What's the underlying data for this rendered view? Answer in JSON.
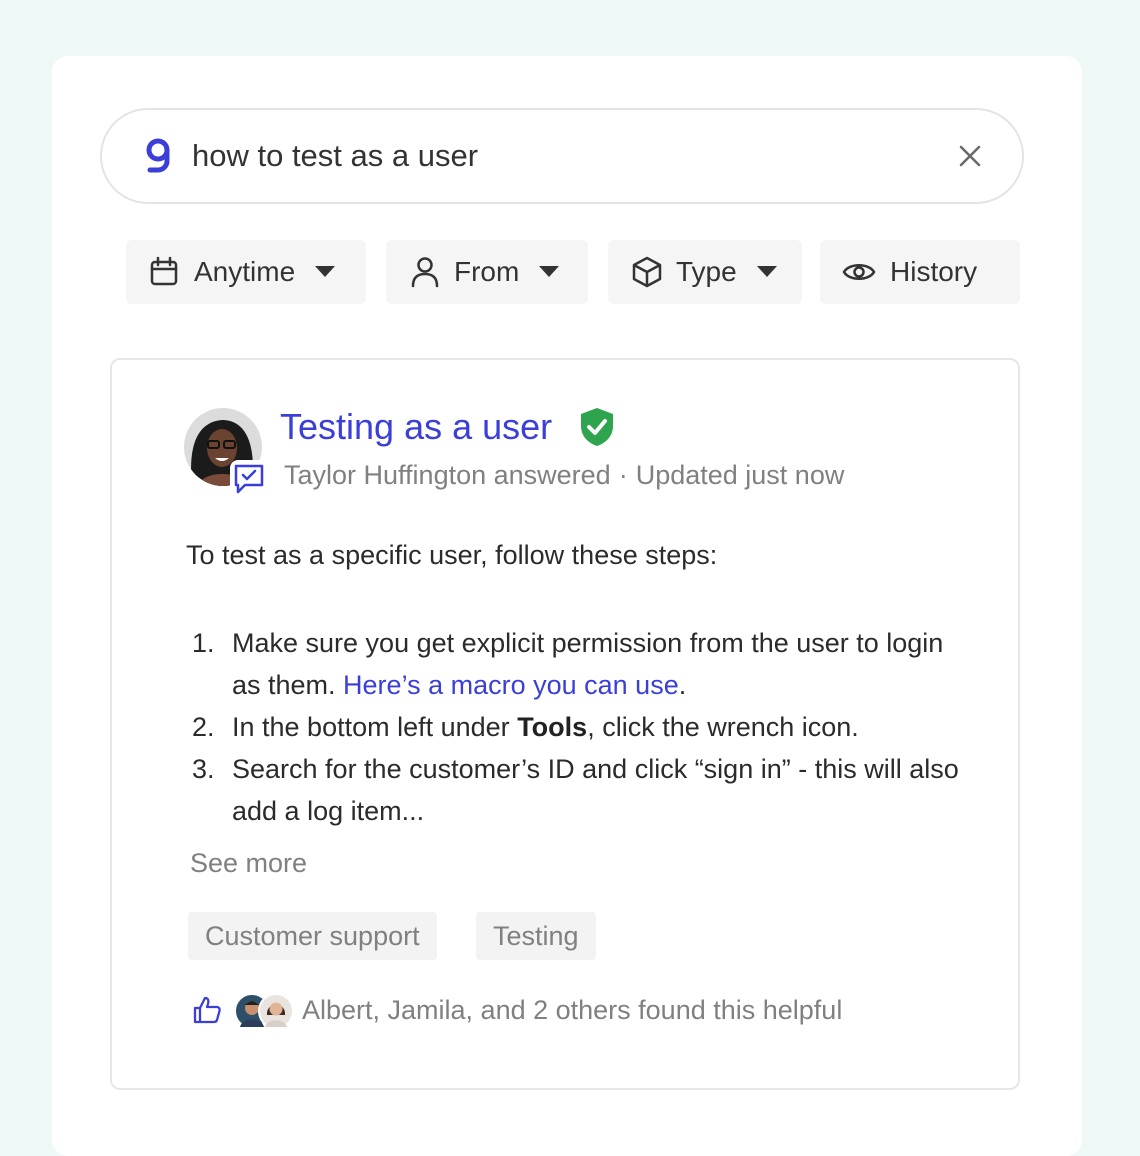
{
  "search": {
    "query": "how to test as a user"
  },
  "filters": [
    {
      "label": "Anytime",
      "icon": "calendar-icon",
      "has_dropdown": true
    },
    {
      "label": "From",
      "icon": "user-icon",
      "has_dropdown": true
    },
    {
      "label": "Type",
      "icon": "cube-icon",
      "has_dropdown": true
    },
    {
      "label": "History",
      "icon": "eye-icon",
      "has_dropdown": false
    }
  ],
  "result": {
    "title": "Testing as a user",
    "verified": true,
    "author_line": "Taylor Huffington answered",
    "separator": "·",
    "updated": "Updated just now",
    "intro": "To test as a specific user, follow these steps:",
    "steps": [
      {
        "num": "1.",
        "text": "Make sure you get explicit permission from the user to login as them. ",
        "link": "Here’s a macro you can use",
        "after": "."
      },
      {
        "num": "2.",
        "before": "In the bottom left under ",
        "bold": "Tools",
        "after": ", click the wrench icon."
      },
      {
        "num": "3.",
        "text": "Search for the customer’s ID and click “sign in” - this will also add a log item..."
      }
    ],
    "see_more": "See more",
    "tags": [
      "Customer support",
      "Testing"
    ],
    "helpful": "Albert, Jamila, and 2 others found this helpful"
  },
  "colors": {
    "accent": "#3b3fd8",
    "verified": "#2ea44f",
    "background": "#eef8f6"
  }
}
